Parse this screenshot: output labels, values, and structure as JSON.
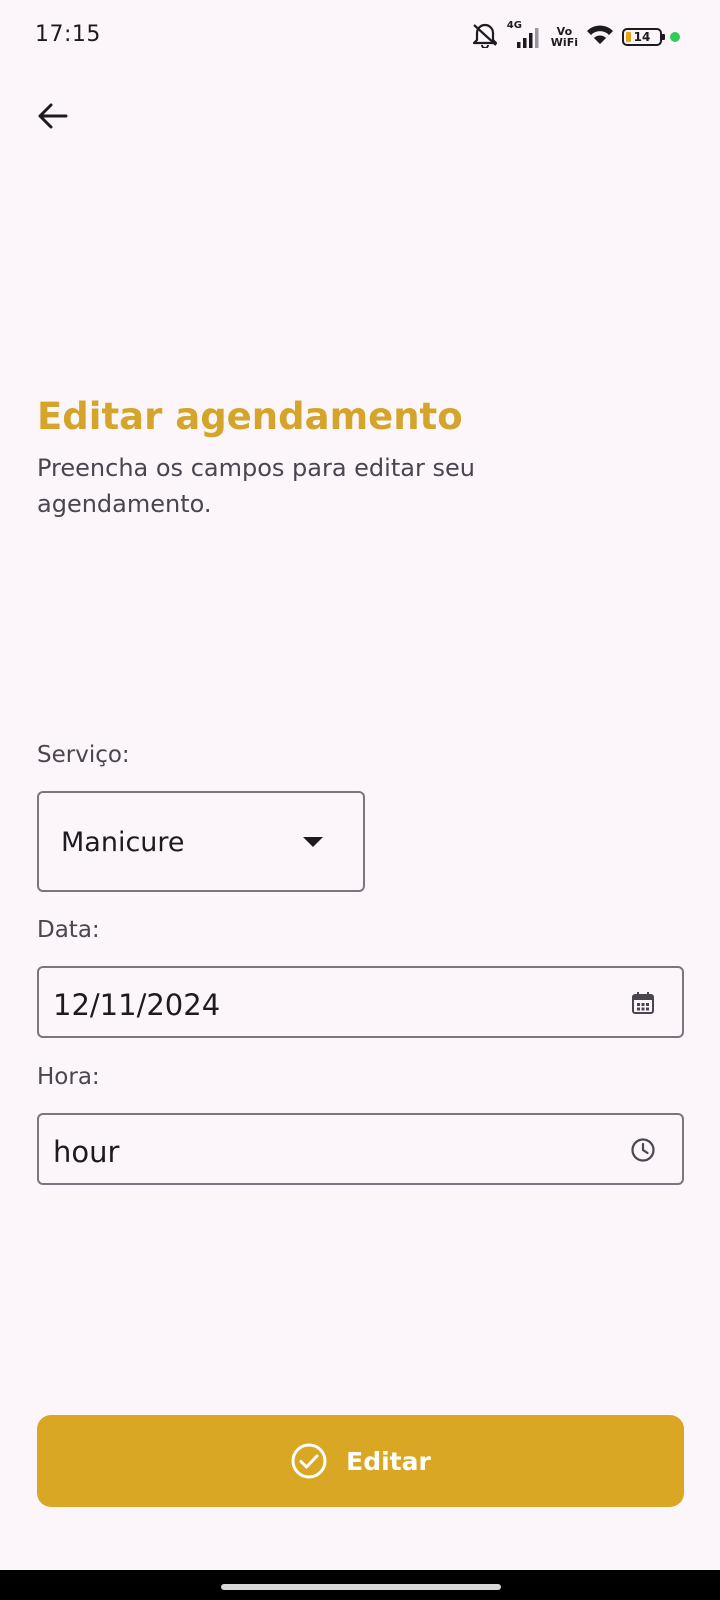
{
  "status_bar": {
    "time": "17:15",
    "network": "4G",
    "vowifi_top": "Vo",
    "vowifi_bottom": "WiFi",
    "battery": "14",
    "icons": [
      "mute-icon",
      "signal-icon",
      "wifi-icon",
      "battery-icon"
    ]
  },
  "header": {
    "back_icon": "arrow-left-icon"
  },
  "page": {
    "title": "Editar agendamento",
    "subtitle": "Preencha os campos para editar seu agendamento."
  },
  "form": {
    "service": {
      "label": "Serviço:",
      "value": "Manicure",
      "icon": "caret-down-icon"
    },
    "date": {
      "label": "Data:",
      "value": "12/11/2024",
      "icon": "calendar-icon"
    },
    "hour": {
      "label": "Hora:",
      "value": "hour",
      "icon": "clock-icon"
    }
  },
  "actions": {
    "submit_label": "Editar",
    "submit_icon": "check-circle-icon"
  },
  "colors": {
    "accent": "#daa724",
    "title": "#d4a52a",
    "background": "#fcf6fb",
    "border": "#7a757f"
  }
}
